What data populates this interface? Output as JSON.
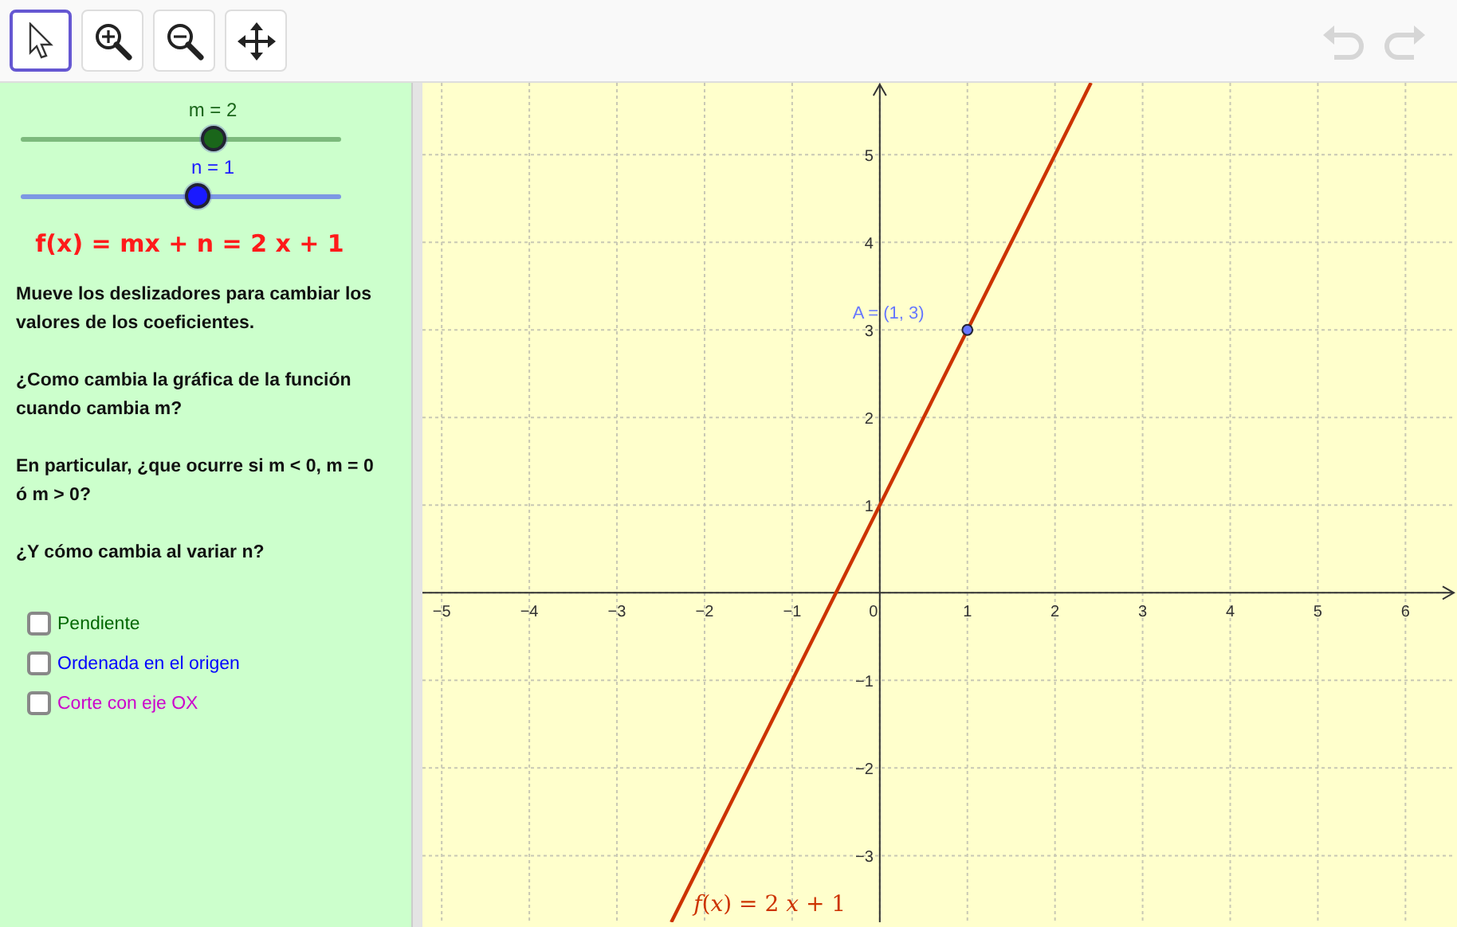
{
  "toolbar": {
    "tools": [
      {
        "kind": "pointer",
        "selected": true
      },
      {
        "kind": "zoom-in",
        "selected": false
      },
      {
        "kind": "zoom-out",
        "selected": false
      },
      {
        "kind": "move",
        "selected": false
      }
    ],
    "history": [
      {
        "kind": "undo",
        "disabled": true
      },
      {
        "kind": "redo",
        "disabled": true
      }
    ]
  },
  "sliders": [
    {
      "label": "m = 2",
      "level": 0.6,
      "color": "#1a661a"
    },
    {
      "label": "n = 1",
      "level": 0.55,
      "color": "#1a1aff"
    }
  ],
  "formula": "f(x) = mx + n = 2 x + 1",
  "paragraphs": [
    "Mueve los deslizadores para cambiar los valores de los coeficientes.",
    "¿Como cambia la gráfica de la función cuando cambia m?",
    "En particular, ¿que ocurre si m < 0, m = 0 ó m > 0?",
    "¿Y cómo cambia al variar n?"
  ],
  "checkboxes": [
    {
      "label": "Pendiente",
      "checked": false,
      "color": "#006600"
    },
    {
      "label": "Ordenada en el origen",
      "checked": false,
      "color": "#0000ff"
    },
    {
      "label": "Corte con eje OX",
      "checked": false,
      "color": "#cc00cc"
    }
  ],
  "graph": {
    "chart_data": {
      "type": "line",
      "grid": true,
      "xlim": [
        -5.22,
        6.57
      ],
      "ylim": [
        -3.76,
        5.82
      ],
      "xticks": [
        {
          "value": -5,
          "label": "−5"
        },
        {
          "value": -4,
          "label": "−4"
        },
        {
          "value": -3,
          "label": "−3"
        },
        {
          "value": -2,
          "label": "−2"
        },
        {
          "value": -1,
          "label": "−1"
        },
        {
          "value": 0,
          "label": "0"
        },
        {
          "value": 1,
          "label": "1"
        },
        {
          "value": 2,
          "label": "2"
        },
        {
          "value": 3,
          "label": "3"
        },
        {
          "value": 4,
          "label": "4"
        },
        {
          "value": 5,
          "label": "5"
        },
        {
          "value": 6,
          "label": "6"
        }
      ],
      "yticks": [
        {
          "value": -3,
          "label": "−3"
        },
        {
          "value": -2,
          "label": "−2"
        },
        {
          "value": -1,
          "label": "−1"
        },
        {
          "value": 1,
          "label": "1"
        },
        {
          "value": 2,
          "label": "2"
        },
        {
          "value": 3,
          "label": "3"
        },
        {
          "value": 4,
          "label": "4"
        },
        {
          "value": 5,
          "label": "5"
        }
      ],
      "x": [
        -2.38,
        2.41
      ],
      "series": [
        {
          "name": "*f*(*x*)  =  2 *x* + 1",
          "color": "#cc3300",
          "values": [
            -3.76,
            5.82
          ]
        }
      ],
      "annotations": [
        {
          "text": "A = (1, 3)",
          "x": 1,
          "y": 3
        }
      ]
    }
  }
}
